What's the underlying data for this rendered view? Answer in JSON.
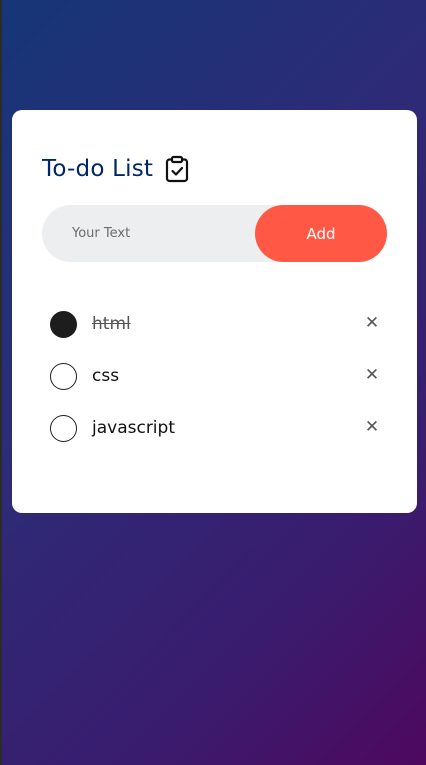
{
  "app": {
    "title": "To-do List",
    "title_icon": "clipboard-check-icon"
  },
  "input": {
    "placeholder": "Your Text",
    "value": ""
  },
  "add_button": {
    "label": "Add"
  },
  "todos": [
    {
      "text": "html",
      "checked": true,
      "remove_glyph": "✕"
    },
    {
      "text": "css",
      "checked": false,
      "remove_glyph": "✕"
    },
    {
      "text": "javascript",
      "checked": false,
      "remove_glyph": "✕"
    }
  ],
  "colors": {
    "accent": "#ff5945",
    "title": "#002765",
    "card": "#ffffff",
    "input_bg": "#edeef0",
    "gradient_start": "#153677",
    "gradient_end": "#4e085f"
  }
}
